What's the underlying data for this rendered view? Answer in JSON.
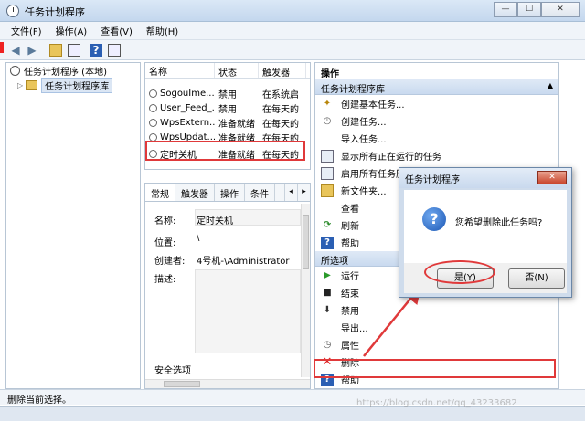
{
  "window": {
    "title": "任务计划程序",
    "buttons": {
      "minimize": "—",
      "maximize": "☐",
      "close": "✕"
    }
  },
  "menu": [
    "文件(F)",
    "操作(A)",
    "查看(V)",
    "帮助(H)"
  ],
  "tree": {
    "root": "任务计划程序 (本地)",
    "child": "任务计划程序库"
  },
  "list": {
    "headers": [
      "名称",
      "状态",
      "触发器"
    ],
    "rows": [
      {
        "name": "SogouIme...",
        "status": "禁用",
        "trigger": "在系统启"
      },
      {
        "name": "User_Feed_...",
        "status": "禁用",
        "trigger": "在每天的"
      },
      {
        "name": "WpsExtern...",
        "status": "准备就绪",
        "trigger": "在每天的"
      },
      {
        "name": "WpsUpdat...",
        "status": "准备就绪",
        "trigger": "在每天的"
      },
      {
        "name": "定时关机",
        "status": "准备就绪",
        "trigger": "在每天的"
      }
    ]
  },
  "detail": {
    "tabs": [
      "常规",
      "触发器",
      "操作",
      "条件"
    ],
    "name_label": "名称:",
    "name_value": "定时关机",
    "location_label": "位置:",
    "location_value": "\\",
    "author_label": "创建者:",
    "author_value": "4号机-\\Administrator",
    "description_label": "描述:",
    "security_label": "安全选项"
  },
  "actions": {
    "title": "操作",
    "section1": "任务计划程序库",
    "items1": [
      "创建基本任务...",
      "创建任务...",
      "导入任务...",
      "显示所有正在运行的任务",
      "启用所有任务历",
      "新文件夹...",
      "查看",
      "刷新",
      "帮助"
    ],
    "section2": "所选项",
    "items2": [
      "运行",
      "结束",
      "禁用",
      "导出...",
      "属性",
      "删除",
      "帮助"
    ]
  },
  "dialog": {
    "title": "任务计划程序",
    "message": "您希望删除此任务吗?",
    "yes": "是(Y)",
    "no": "否(N)"
  },
  "status": "删除当前选择。",
  "watermark": "https://blog.csdn.net/qq_43233682"
}
